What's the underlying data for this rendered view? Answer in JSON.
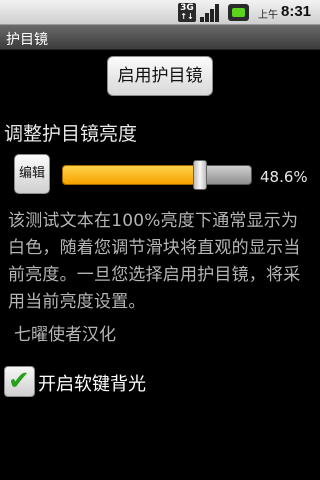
{
  "status_bar": {
    "network_badge_top": "3G",
    "network_badge_bottom": "↑↓",
    "signal_icon": "signal-bars-icon",
    "battery_icon": "battery-icon",
    "am_pm": "上午",
    "time": "8:31"
  },
  "titlebar": {
    "title": "护目镜"
  },
  "enable_button": {
    "label": "启用护目镜"
  },
  "brightness": {
    "label": "调整护目镜亮度",
    "edit_button_label": "编辑",
    "slider_value": 0.486,
    "value_text": "48.6%"
  },
  "description": {
    "text": "该测试文本在100%亮度下通常显示为白色，随着您调节滑块将直观的显示当前亮度。一旦您选择启用护目镜，将采用当前亮度设置。",
    "credit": "七曜使者汉化"
  },
  "backlight": {
    "checked": true,
    "label": "开启软键背光"
  },
  "colors": {
    "slider_fill": "#f6a200",
    "check": "#27a11d"
  }
}
